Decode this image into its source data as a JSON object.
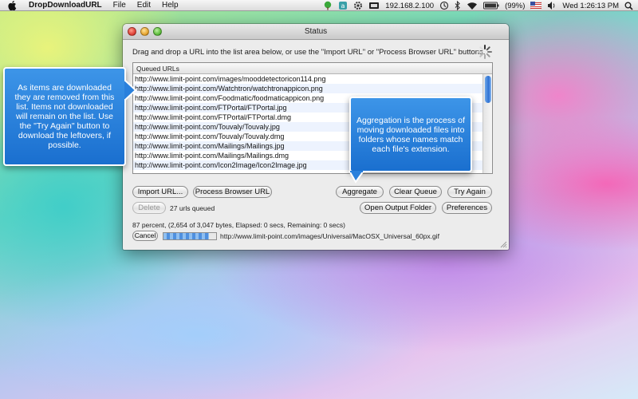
{
  "menubar": {
    "app_name": "DropDownloadURL",
    "items": [
      "File",
      "Edit",
      "Help"
    ],
    "ip_address": "192.168.2.100",
    "battery_percent": "(99%)",
    "clock": "Wed 1:26:13 PM"
  },
  "window": {
    "title": "Status",
    "instructions": "Drag and drop a URL into the list area below, or use the \"Import URL\" or \"Process Browser URL\" buttons.",
    "list_header": "Queued URLs",
    "urls": [
      "http://www.limit-point.com/images/mooddetectoricon114.png",
      "http://www.limit-point.com/Watchtron/watchtronappicon.png",
      "http://www.limit-point.com/Foodmatic/foodmaticappicon.png",
      "http://www.limit-point.com/FTPortal/FTPortal.jpg",
      "http://www.limit-point.com/FTPortal/FTPortal.dmg",
      "http://www.limit-point.com/Touvaly/Touvaly.jpg",
      "http://www.limit-point.com/Touvaly/Touvaly.dmg",
      "http://www.limit-point.com/Mailings/Mailings.jpg",
      "http://www.limit-point.com/Mailings/Mailings.dmg",
      "http://www.limit-point.com/Icon2Image/Icon2Image.jpg"
    ],
    "buttons": {
      "import_url": "Import URL...",
      "process_browser_url": "Process Browser URL",
      "aggregate": "Aggregate",
      "clear_queue": "Clear Queue",
      "try_again": "Try Again",
      "delete": "Delete",
      "open_output_folder": "Open Output Folder",
      "preferences": "Preferences",
      "cancel": "Cancel"
    },
    "queue_count": "27 urls queued",
    "status_line": "87 percent, (2,654 of 3,047 bytes, Elapsed: 0 secs, Remaining: 0 secs)",
    "progress_fraction": 0.87,
    "current_url": "http://www.limit-point.com/images/Universal/MacOSX_Universal_60px.gif"
  },
  "callouts": {
    "left": "As items are downloaded they are removed from this list. Items not downloaded will remain on the list. Use the \"Try Again\" button to download the leftovers, if possible.",
    "right": "Aggregation is the process of moving downloaded files into folders whose names match each file's extension."
  },
  "colors": {
    "callout_blue": "#2a80dc",
    "scroll_thumb": "#2f72d3",
    "alt_row": "#edf3fe"
  }
}
